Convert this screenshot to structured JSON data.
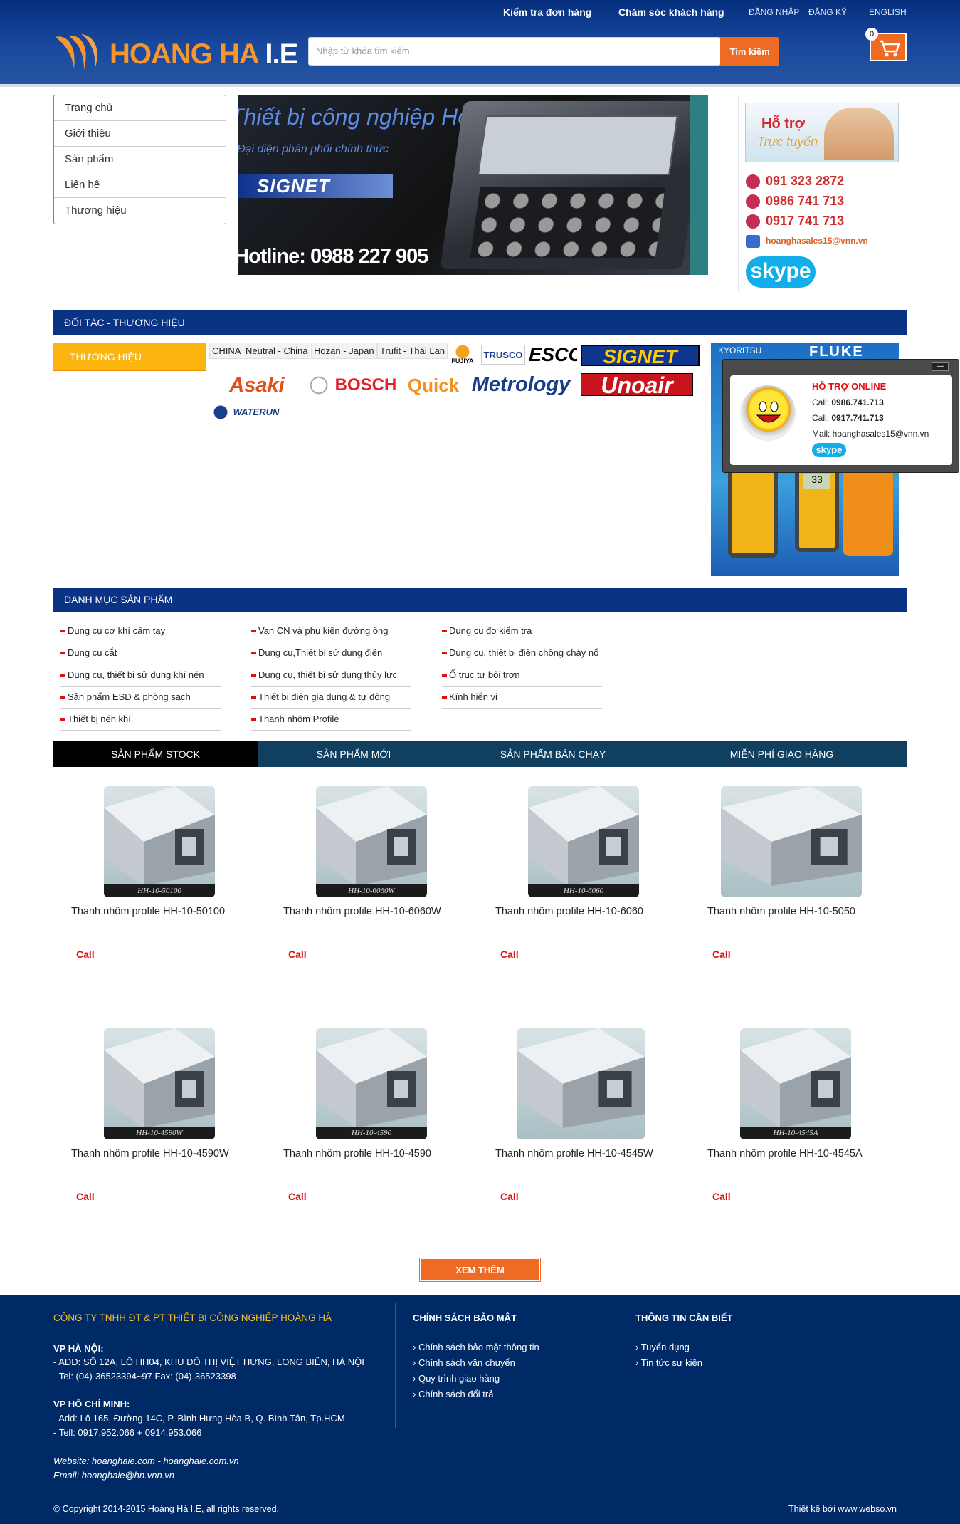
{
  "header": {
    "order_check": "Kiểm tra đơn hàng",
    "customer_care": "Chăm sóc khách hàng",
    "login": "ĐĂNG NHẬP",
    "register": "ĐĂNG KÝ",
    "language": "ENGLISH",
    "logo_main": "HOANG HA",
    "logo_suffix": " I.E",
    "search_placeholder": "Nhập từ khóa tìm kiếm",
    "search_button": "Tìm kiếm",
    "cart_count": "0"
  },
  "menu": [
    "Trang chủ",
    "Giới thiệu",
    "Sản phẩm",
    "Liên hệ",
    "Thương hiệu"
  ],
  "banner": {
    "title": "Thiết bị công nghiệp Hoàng Hà",
    "subtitle": "Đại diện phân phối chính thức",
    "brand": "SIGNET",
    "hotline": "Hotline: 0988 227 905"
  },
  "support": {
    "badge_line1": "Hỗ trợ",
    "badge_line2": "Trực tuyến",
    "phones": [
      "091 323 2872",
      "0986 741 713",
      "0917 741 713"
    ],
    "email": "hoanghasales15@vnn.vn",
    "skype": "skype"
  },
  "partners": {
    "section_title": "ĐỐI TÁC - THƯƠNG HIỆU",
    "tab": "THƯƠNG HIỆU",
    "text_brands": [
      "CHINA",
      "Neutral - China",
      "Hozan - Japan",
      "Trufit - Thái Lan"
    ],
    "logo_brands": [
      "FUJIYA",
      "TRUSCO",
      "ESCO",
      "SIGNET",
      "Asaki",
      "BOSCH",
      "Quick",
      "Metrology",
      "Unoair",
      "WATERUN"
    ],
    "side_banner_brands": [
      "KYORITSU",
      "FLUKE"
    ],
    "meter_reading": "33"
  },
  "popup": {
    "title": "HỖ TRỢ ONLINE",
    "call_label": "Call: ",
    "call1": "0986.741.713",
    "call2": "0917.741.713",
    "mail_label": "Mail: ",
    "mail": "hoanghasales15@vnn.vn",
    "skype": "skype",
    "minimize": "—"
  },
  "categories": {
    "title": "DANH MỤC SẢN PHẨM",
    "col1": [
      "Dụng cụ cơ khí cầm tay",
      "Dụng cụ cắt",
      "Dụng cụ, thiết bị sử dụng khí nén",
      "Sản phẩm ESD & phòng sạch",
      "Thiết bị nén khí"
    ],
    "col2": [
      "Van CN và phụ kiện đường ống",
      "Dụng cụ,Thiết bị sử dụng điện",
      "Dụng cụ, thiết bị sử dụng thủy lực",
      "Thiết bị điện gia dụng & tự động",
      "Thanh nhôm Profile"
    ],
    "col3": [
      "Dụng cụ đo kiểm tra",
      "Dụng cụ, thiết bị điện chống cháy nổ",
      "Ổ trục tự bôi trơn",
      "Kính hiển vi"
    ]
  },
  "tabs": [
    "SẢN PHẨM STOCK",
    "SẢN PHẨM MỚI",
    "SẢN PHẨM BÁN CHẠY",
    "MIỄN PHÍ GIAO HÀNG"
  ],
  "products": [
    {
      "name": "Thanh nhôm profile HH-10-50100",
      "code": "HH-10-50100",
      "price": "Call"
    },
    {
      "name": "Thanh nhôm profile HH-10-6060W",
      "code": "HH-10-6060W",
      "price": "Call"
    },
    {
      "name": "Thanh nhôm profile HH-10-6060",
      "code": "HH-10-6060",
      "price": "Call"
    },
    {
      "name": "Thanh nhôm profile HH-10-5050",
      "code": "",
      "price": "Call"
    },
    {
      "name": "Thanh nhôm profile HH-10-4590W",
      "code": "HH-10-4590W",
      "price": "Call"
    },
    {
      "name": "Thanh nhôm profile HH-10-4590",
      "code": "HH-10-4590",
      "price": "Call"
    },
    {
      "name": "Thanh nhôm profile HH-10-4545W",
      "code": "",
      "price": "Call"
    },
    {
      "name": "Thanh nhôm profile HH-10-4545A",
      "code": "HH-10-4545A",
      "price": "Call"
    }
  ],
  "more_button": "XEM THÊM",
  "footer": {
    "company": "CÔNG TY TNHH ĐT & PT THIẾT BỊ CÔNG NGHIỆP HOÀNG HÀ",
    "hn_title": "VP HÀ NỘI:",
    "hn_addr": "- ADD: SỐ 12A, LÔ HH04, KHU ĐÔ THỊ VIỆT HƯNG, LONG BIÊN, HÀ NỘI",
    "hn_tel": "- Tel: (04)-36523394~97 Fax: (04)-36523398",
    "hcm_title": "VP HỒ CHÍ MINH:",
    "hcm_addr": "- Add: Lô 165, Đường 14C, P. Bình Hưng Hòa B, Q. Bình Tân, Tp.HCM",
    "hcm_tel": "- Tell: 0917.952.066 + 0914.953.066",
    "website": "Website: hoanghaie.com - hoanghaie.com.vn",
    "email": "Email: hoanghaie@hn.vnn.vn",
    "policy_title": "CHÍNH SÁCH BẢO MẬT",
    "policy_links": [
      "Chính sách bảo mật thông tin",
      "Chính sách vận chuyển",
      "Quy trình giao hàng",
      "Chính sách đổi trả"
    ],
    "info_title": "THÔNG TIN CẦN BIẾT",
    "info_links": [
      "Tuyển dụng",
      "Tin tức sự kiện"
    ],
    "copyright": "© Copyright 2014-2015 Hoàng Hà I.E, all rights reserved.",
    "design": "Thiết kế bởi www.webso.vn"
  },
  "colors": {
    "navy": "#0a3386",
    "orange": "#ef6a23",
    "yellow": "#fcb40f",
    "red": "#d11111",
    "footer": "#002a66"
  }
}
